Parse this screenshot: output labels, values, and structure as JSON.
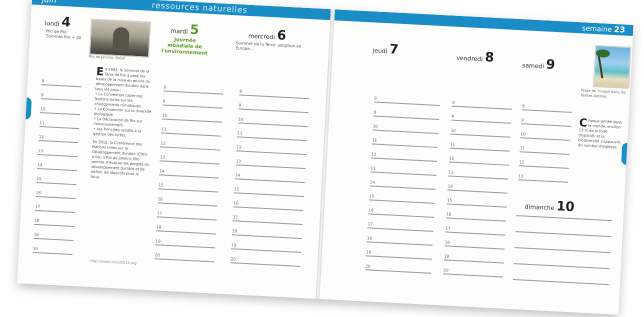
{
  "header": {
    "month": "juin",
    "theme": "ressources naturelles",
    "right_label": "semaine",
    "page_number": "23"
  },
  "days": [
    {
      "name": "lundi",
      "num": "4"
    },
    {
      "name": "mardi",
      "num": "5"
    },
    {
      "name": "mercredi",
      "num": "6"
    },
    {
      "name": "jeudi",
      "num": "7"
    },
    {
      "name": "vendredi",
      "num": "8"
    },
    {
      "name": "samedi",
      "num": "9"
    }
  ],
  "sunday": {
    "name": "dimanche",
    "num": "10"
  },
  "notes": {
    "lundi": "Rio de Rio \nSommet Rio + 20",
    "mardi_event": "Journée\nmondiale de\nl'environnement",
    "mercredi": "Sommet de la Terre: adoption en Europe..."
  },
  "photos": {
    "left_caption": "Rio de Janeiro, Brésil",
    "right_caption": "Plage de Tiraguil dans les Petites Antilles"
  },
  "article_left": {
    "dropcap": "E",
    "intro": "n 1992, le Sommet de la Terre de Rio a posé les bases de la mise en œuvre du développement durable dans tous les pays :",
    "bullets": [
      "• La Convention cadre des Nations Unies sur les changements climatiques.",
      "• La Convention sur la diversité biologique.",
      "• La Déclaration de Rio sur l'environnement.",
      "• Les Principes relatifs à la gestion des forêts."
    ],
    "para2": "En 2012, la Conférence des Nations Unies sur le Développement durable (CDD) a lieu à Rio de Janeiro. Elle permet d'évaluer les progrès du développement durable et de définir les objectifs pour le futur.",
    "url": "http://www.uncsd2012.org"
  },
  "article_right": {
    "dropcap": "C",
    "text": "haque année dans le monde, environ 13 % de la forêt disparaît, et la biodiversité s'appauvrit en nombre d'espèces."
  },
  "hours": [
    "8",
    "9",
    "10",
    "11",
    "12",
    "13",
    "14",
    "15",
    "16",
    "17",
    "18",
    "19",
    "20"
  ]
}
